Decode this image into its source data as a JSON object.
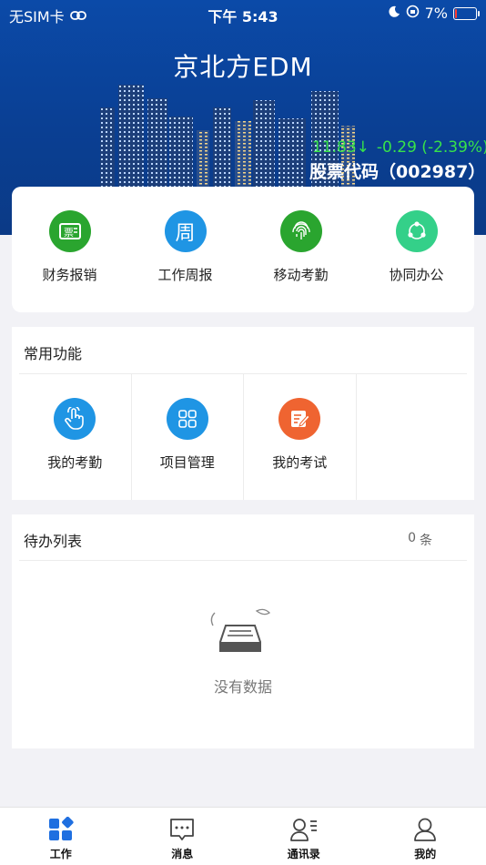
{
  "status_bar": {
    "carrier": "无SIM卡",
    "time": "下午 5:43",
    "battery": "7%",
    "battery_level": 0.07
  },
  "header": {
    "title": "京北方EDM",
    "stock_price": "11.83↓",
    "stock_change": "-0.29 (-2.39%)",
    "stock_code": "股票代码（002987）"
  },
  "quick_actions": [
    {
      "label": "财务报销",
      "icon": "invoice-icon",
      "color": "#2aa52f"
    },
    {
      "label": "工作周报",
      "icon": "week-icon",
      "color": "#1f95e4"
    },
    {
      "label": "移动考勤",
      "icon": "fingerprint-icon",
      "color": "#2aa52f"
    },
    {
      "label": "协同办公",
      "icon": "share-icon",
      "color": "#34d089"
    }
  ],
  "common_functions": {
    "title": "常用功能",
    "items": [
      {
        "label": "我的考勤",
        "icon": "hand-tap-icon",
        "color": "#1f95e4"
      },
      {
        "label": "项目管理",
        "icon": "grid-icon",
        "color": "#1f95e4"
      },
      {
        "label": "我的考试",
        "icon": "edit-note-icon",
        "color": "#ef6431"
      }
    ]
  },
  "todo": {
    "title": "待办列表",
    "count": "0",
    "count_unit": "条",
    "empty_text": "没有数据"
  },
  "tabbar": [
    {
      "label": "工作",
      "icon": "grid-diamond-icon",
      "active": true,
      "color": "#1f6fe0"
    },
    {
      "label": "消息",
      "icon": "message-icon",
      "active": false
    },
    {
      "label": "通讯录",
      "icon": "contacts-icon",
      "active": false
    },
    {
      "label": "我的",
      "icon": "person-icon",
      "active": false
    }
  ]
}
